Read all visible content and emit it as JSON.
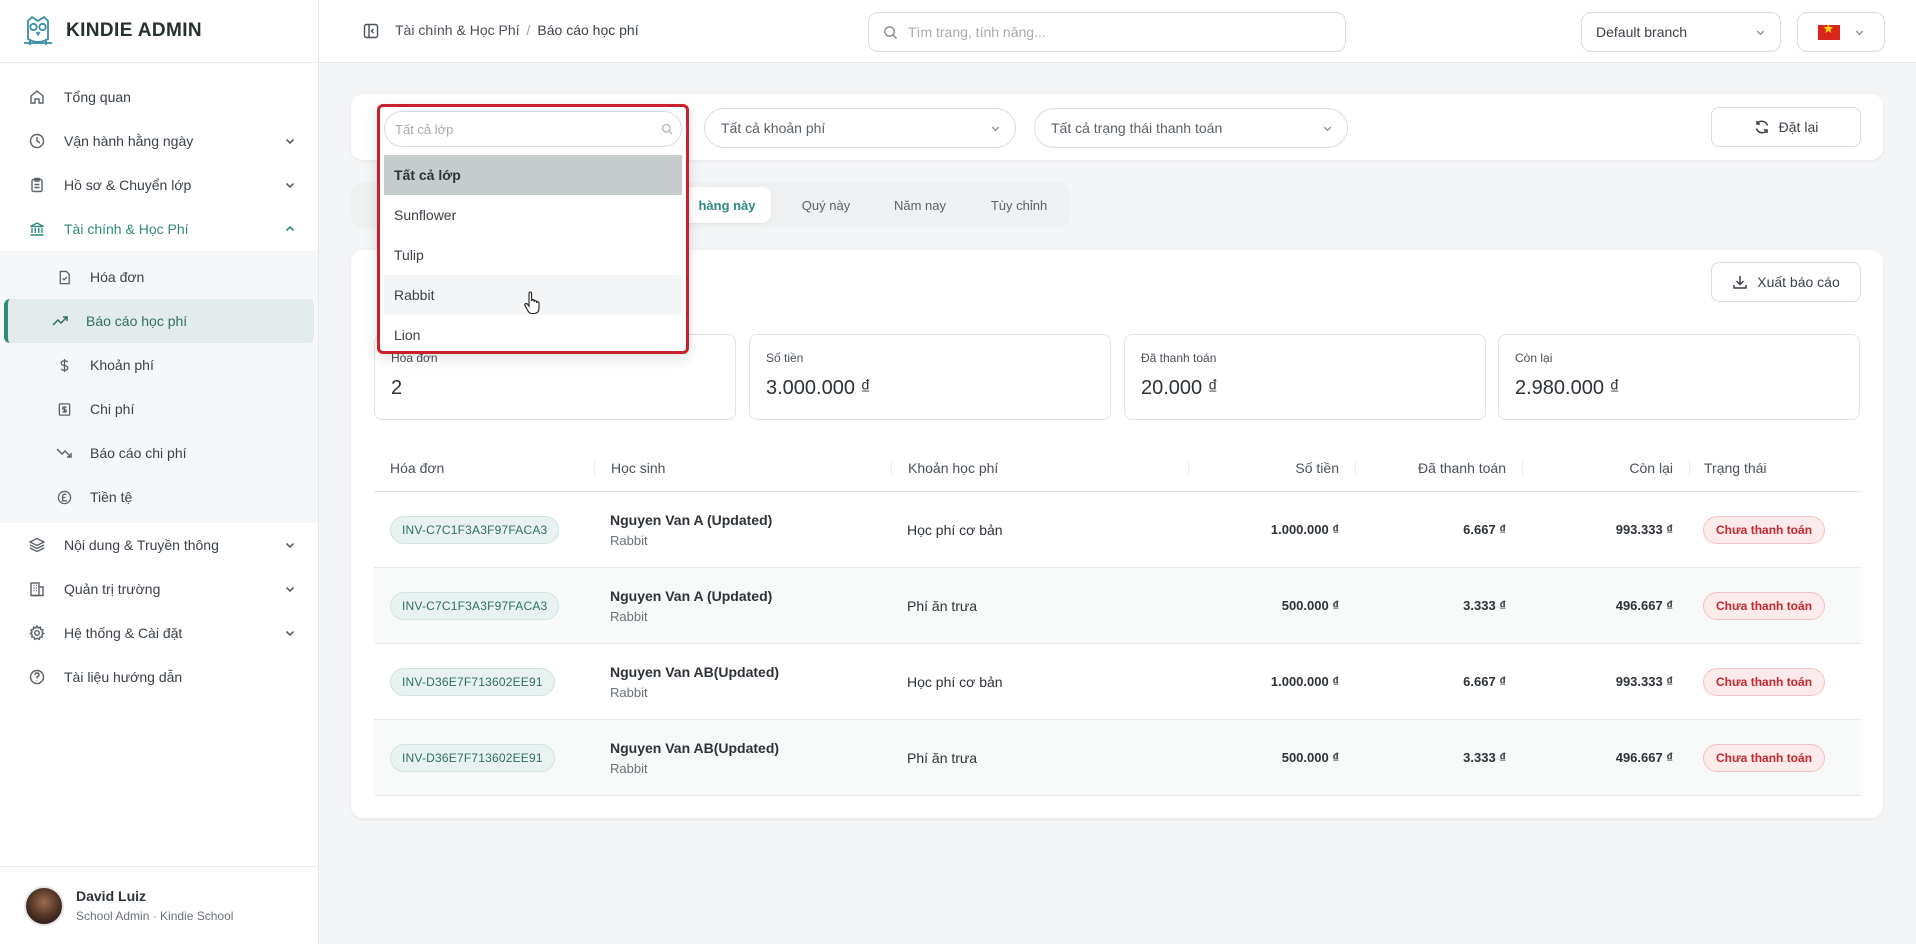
{
  "app": {
    "brand": "KINDIE ADMIN"
  },
  "sidebar": {
    "items": [
      {
        "label": "Tổng quan",
        "icon": "home-icon"
      },
      {
        "label": "Vận hành hằng ngày",
        "icon": "clock-icon"
      },
      {
        "label": "Hồ sơ & Chuyển lớp",
        "icon": "clipboard-icon"
      },
      {
        "label": "Tài chính & Học Phí",
        "icon": "bank-icon"
      },
      {
        "label": "Nội dung & Truyền thông",
        "icon": "layers-icon"
      },
      {
        "label": "Quản trị trường",
        "icon": "building-icon"
      },
      {
        "label": "Hệ thống & Cài đặt",
        "icon": "gear-icon"
      },
      {
        "label": "Tài liệu hướng dẫn",
        "icon": "help-icon"
      }
    ],
    "finance_sub": [
      {
        "label": "Hóa đơn",
        "icon": "invoice-icon"
      },
      {
        "label": "Báo cáo học phí",
        "icon": "trending-up-icon"
      },
      {
        "label": "Khoản phí",
        "icon": "dollar-icon"
      },
      {
        "label": "Chi phí",
        "icon": "receipt-icon"
      },
      {
        "label": "Báo cáo chi phí",
        "icon": "trending-down-icon"
      },
      {
        "label": "Tiền tệ",
        "icon": "currency-icon"
      }
    ]
  },
  "user": {
    "name": "David Luiz",
    "role": "School Admin · Kindie School"
  },
  "topbar": {
    "breadcrumb": [
      "Tài chính & Học Phí",
      "Báo cáo học phí"
    ],
    "search_placeholder": "Tìm trang, tính năng...",
    "branch": "Default branch"
  },
  "filters": {
    "class_placeholder": "Tất cả lớp",
    "fee": "Tất cả khoản phí",
    "status": "Tất cả trạng thái thanh toán",
    "reset": "Đặt lại"
  },
  "dropdown": {
    "options": [
      "Tất cả lớp",
      "Sunflower",
      "Tulip",
      "Rabbit",
      "Lion"
    ]
  },
  "periods": [
    "hàng này",
    "Quý này",
    "Năm nay",
    "Tùy chỉnh"
  ],
  "report": {
    "export": "Xuất báo cáo",
    "stats": [
      {
        "label": "Hóa đơn",
        "value": "2"
      },
      {
        "label": "Số tiền",
        "value": "3.000.000 ₫"
      },
      {
        "label": "Đã thanh toán",
        "value": "20.000 ₫"
      },
      {
        "label": "Còn lại",
        "value": "2.980.000 ₫"
      }
    ],
    "columns": [
      "Hóa đơn",
      "Học sinh",
      "Khoản học phí",
      "Số tiền",
      "Đã thanh toán",
      "Còn lại",
      "Trạng thái"
    ],
    "rows": [
      {
        "invoice": "INV-C7C1F3A3F97FACA3",
        "student": "Nguyen Van A (Updated)",
        "class": "Rabbit",
        "fee": "Học phí cơ bản",
        "amount": "1.000.000 ₫",
        "paid": "6.667 ₫",
        "remaining": "993.333 ₫",
        "status": "Chưa thanh toán"
      },
      {
        "invoice": "INV-C7C1F3A3F97FACA3",
        "student": "Nguyen Van A (Updated)",
        "class": "Rabbit",
        "fee": "Phí ăn trưa",
        "amount": "500.000 ₫",
        "paid": "3.333 ₫",
        "remaining": "496.667 ₫",
        "status": "Chưa thanh toán"
      },
      {
        "invoice": "INV-D36E7F713602EE91",
        "student": "Nguyen Van AB(Updated)",
        "class": "Rabbit",
        "fee": "Học phí cơ bản",
        "amount": "1.000.000 ₫",
        "paid": "6.667 ₫",
        "remaining": "993.333 ₫",
        "status": "Chưa thanh toán"
      },
      {
        "invoice": "INV-D36E7F713602EE91",
        "student": "Nguyen Van AB(Updated)",
        "class": "Rabbit",
        "fee": "Phí ăn trưa",
        "amount": "500.000 ₫",
        "paid": "3.333 ₫",
        "remaining": "496.667 ₫",
        "status": "Chưa thanh toán"
      }
    ]
  },
  "colors": {
    "accent": "#2f8a7c",
    "danger": "#c6262e",
    "highlight": "#c8202c"
  }
}
